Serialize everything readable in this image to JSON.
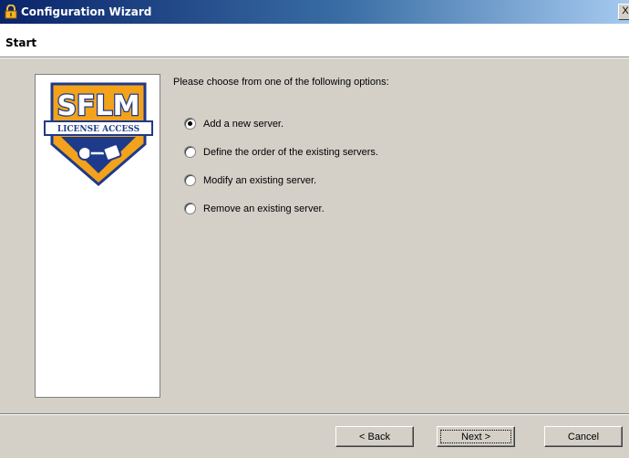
{
  "window": {
    "title": "Configuration Wizard",
    "close_glyph": "X"
  },
  "header": {
    "page_title": "Start"
  },
  "logo": {
    "brand": "SFLM",
    "subtitle": "LICENSE ACCESS",
    "colors": {
      "orange": "#f3a21b",
      "navy": "#1e3a8a"
    }
  },
  "content": {
    "prompt": "Please choose from one of the following options:",
    "options": [
      {
        "label": "Add a new server.",
        "selected": true
      },
      {
        "label": "Define the order of the existing servers.",
        "selected": false
      },
      {
        "label": "Modify an existing server.",
        "selected": false
      },
      {
        "label": "Remove an existing server.",
        "selected": false
      }
    ]
  },
  "footer": {
    "back_label": "< Back",
    "next_label": "Next >",
    "cancel_label": "Cancel"
  },
  "colors": {
    "dialog_face": "#d4d0c8",
    "titlebar_start": "#0a246a",
    "titlebar_end": "#a6caf0"
  }
}
